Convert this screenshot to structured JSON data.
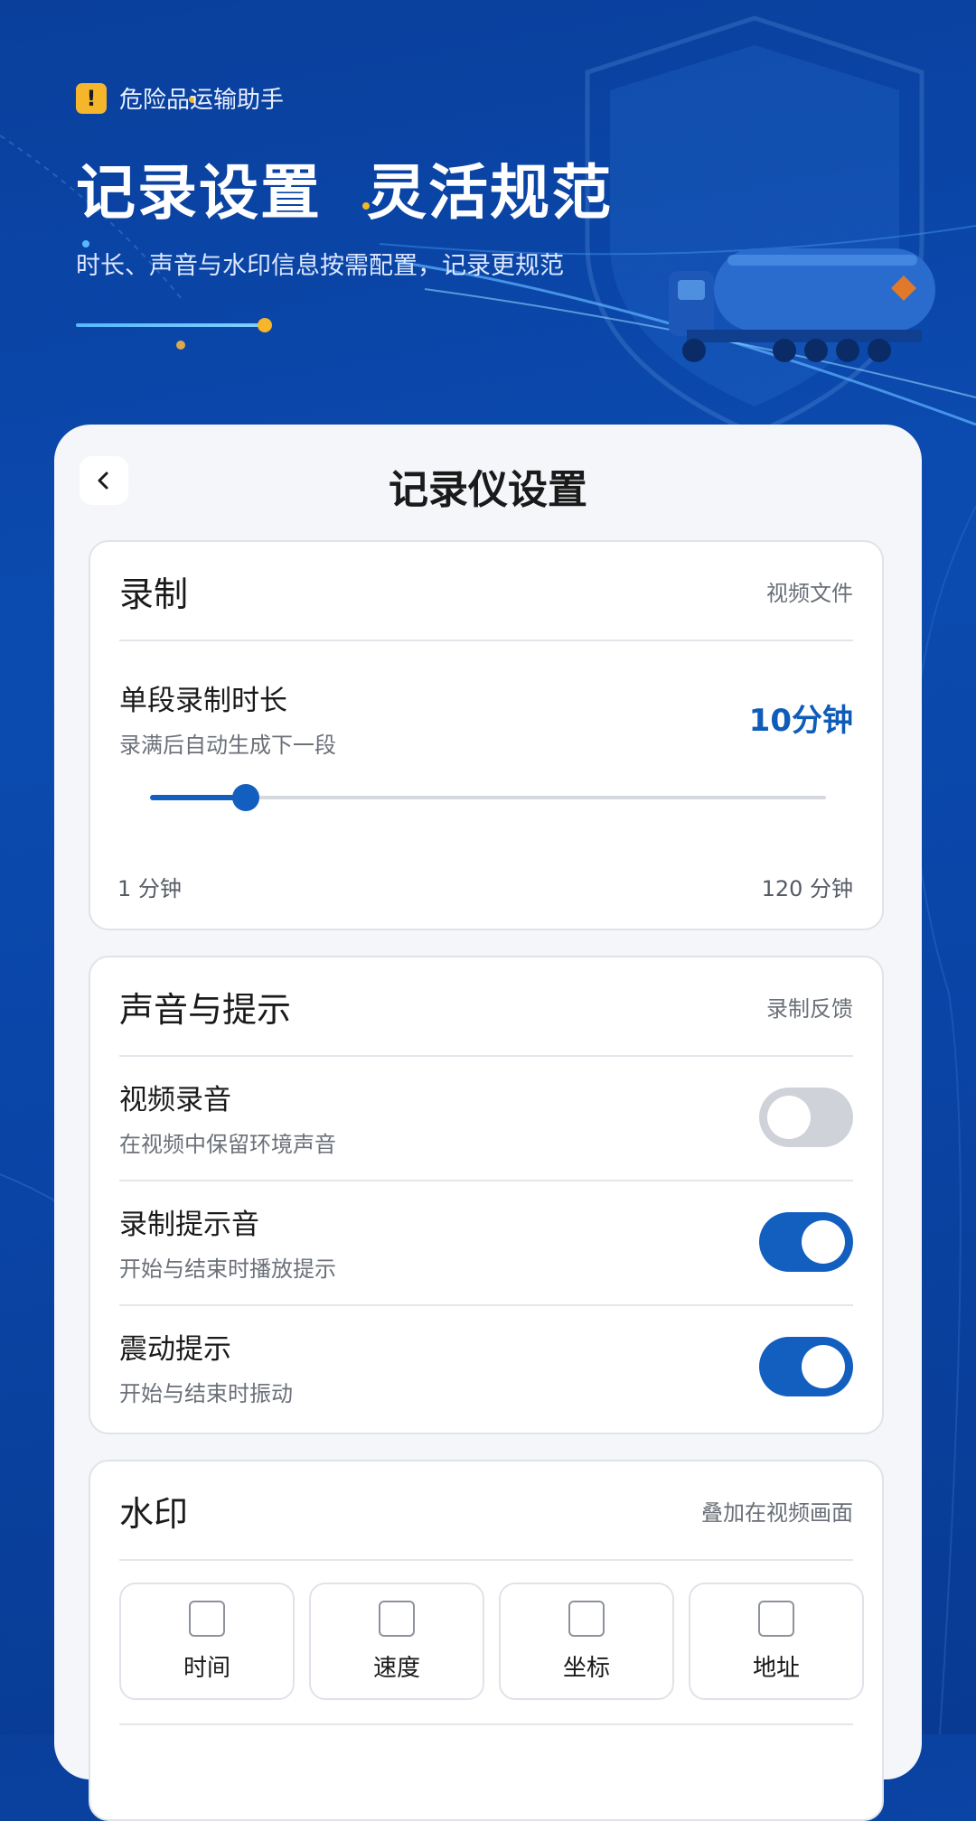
{
  "hero": {
    "brand": "危险品运输助手",
    "title": "记录设置  灵活规范",
    "subtitle": "时长、声音与水印信息按需配置，记录更规范"
  },
  "topbar": {
    "title": "记录仪设置"
  },
  "recording": {
    "title": "录制",
    "note": "视频文件",
    "duration": {
      "label": "单段录制时长",
      "desc": "录满后自动生成下一段",
      "value_text": "10分钟",
      "min_label": "1 分钟",
      "max_label": "120 分钟",
      "min": 1,
      "max": 120,
      "value": 10
    }
  },
  "sound": {
    "title": "声音与提示",
    "note": "录制反馈",
    "items": [
      {
        "label": "视频录音",
        "desc": "在视频中保留环境声音",
        "on": false
      },
      {
        "label": "录制提示音",
        "desc": "开始与结束时播放提示",
        "on": true
      },
      {
        "label": "震动提示",
        "desc": "开始与结束时振动",
        "on": true
      }
    ]
  },
  "watermark": {
    "title": "水印",
    "note": "叠加在视频画面",
    "options": [
      {
        "label": "时间",
        "checked": false
      },
      {
        "label": "速度",
        "checked": false
      },
      {
        "label": "坐标",
        "checked": false
      },
      {
        "label": "地址",
        "checked": false
      }
    ]
  },
  "colors": {
    "accent": "#135fbf",
    "warning": "#f5b62b",
    "background": "#0b4bb0"
  }
}
